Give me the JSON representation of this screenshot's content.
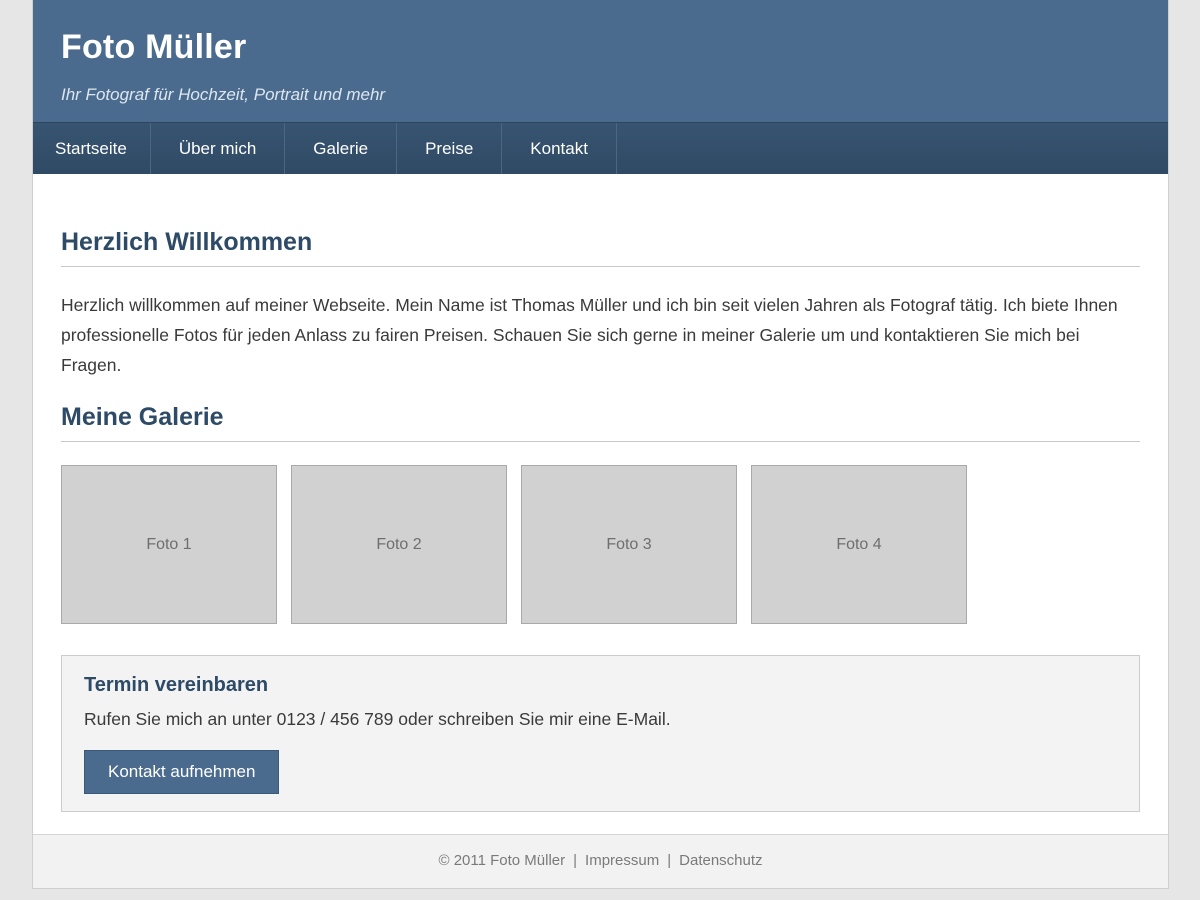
{
  "header": {
    "title": "Foto Müller",
    "tagline": "Ihr Fotograf für Hochzeit, Portrait und mehr"
  },
  "nav": {
    "items": [
      "Startseite",
      "Über mich",
      "Galerie",
      "Preise",
      "Kontakt"
    ]
  },
  "welcome": {
    "heading": "Herzlich Willkommen",
    "text": "Herzlich willkommen auf meiner Webseite. Mein Name ist Thomas Müller und ich bin seit vielen Jahren als Fotograf tätig. Ich biete Ihnen professionelle Fotos für jeden Anlass zu fairen Preisen. Schauen Sie sich gerne in meiner Galerie um und kontaktieren Sie mich bei Fragen."
  },
  "gallery": {
    "heading": "Meine Galerie",
    "photos": [
      "Foto 1",
      "Foto 2",
      "Foto 3",
      "Foto 4"
    ]
  },
  "appointment": {
    "heading": "Termin vereinbaren",
    "text": "Rufen Sie mich an unter 0123 / 456 789 oder schreiben Sie mir eine E-Mail.",
    "button_label": "Kontakt aufnehmen"
  },
  "footer": {
    "copyright": "© 2011 Foto Müller",
    "separator": "|",
    "impressum": "Impressum",
    "datenschutz": "Datenschutz"
  },
  "colors": {
    "header_bg": "#4a6b8e",
    "nav_bg": "#34506c",
    "heading": "#2d4a66",
    "photo_placeholder": "#d1d1d1",
    "page_bg": "#e6e6e6"
  }
}
